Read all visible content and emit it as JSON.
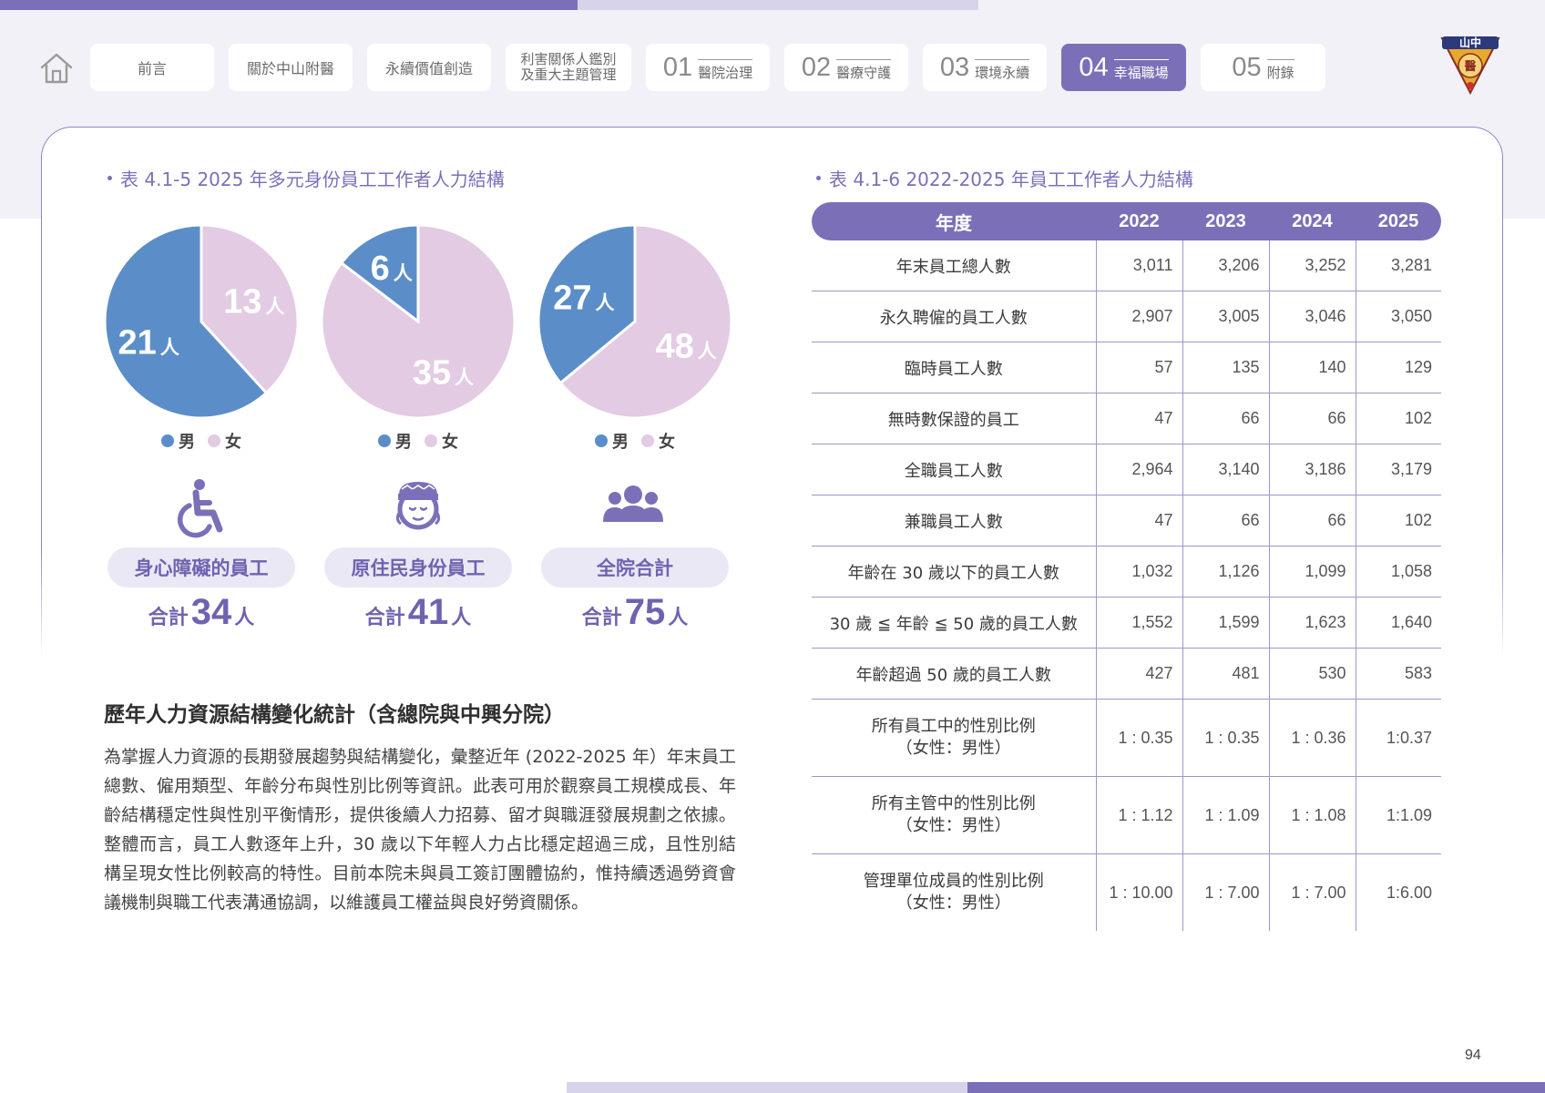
{
  "nav": {
    "tabs": [
      {
        "label": "前言"
      },
      {
        "label": "關於中山附醫"
      },
      {
        "label": "永續價值創造"
      },
      {
        "label_line1": "利害關係人鑑別",
        "label_line2": "及重大主題管理"
      },
      {
        "num": "01",
        "label": "醫院治理"
      },
      {
        "num": "02",
        "label": "醫療守護"
      },
      {
        "num": "03",
        "label": "環境永續"
      },
      {
        "num": "04",
        "label": "幸福職場"
      },
      {
        "num": "05",
        "label": "附錄"
      }
    ]
  },
  "logo": {
    "text": "山中",
    "text2": "醫"
  },
  "left": {
    "title": "表 4.1-5  2025 年多元身份員工工作者人力結構",
    "legend": {
      "male": "男",
      "female": "女"
    },
    "person_unit": "人",
    "total_prefix": "合計",
    "groups": [
      {
        "name": "身心障礙的員工",
        "male": "21",
        "female": "13",
        "total": "34"
      },
      {
        "name": "原住民身份員工",
        "male": "6",
        "female": "35",
        "total": "41"
      },
      {
        "name": "全院合計",
        "male": "27",
        "female": "48",
        "total": "75"
      }
    ]
  },
  "chart_data": [
    {
      "type": "pie",
      "categories": [
        "男",
        "女"
      ],
      "values": [
        21,
        13
      ],
      "colors": [
        "#5b8ec8",
        "#e2cbe3"
      ]
    },
    {
      "type": "pie",
      "categories": [
        "男",
        "女"
      ],
      "values": [
        6,
        35
      ],
      "colors": [
        "#5b8ec8",
        "#e2cbe3"
      ]
    },
    {
      "type": "pie",
      "categories": [
        "男",
        "女"
      ],
      "values": [
        27,
        48
      ],
      "colors": [
        "#5b8ec8",
        "#e2cbe3"
      ]
    }
  ],
  "section": {
    "heading": "歷年人力資源結構變化統計（含總院與中興分院）",
    "paragraph": "為掌握人力資源的長期發展趨勢與結構變化，彙整近年 (2022-2025 年）年末員工總數、僱用類型、年齡分布與性別比例等資訊。此表可用於觀察員工規模成長、年齡結構穩定性與性別平衡情形，提供後續人力招募、留才與職涯發展規劃之依據。整體而言，員工人數逐年上升，30 歲以下年輕人力占比穩定超過三成，且性別結構呈現女性比例較高的特性。目前本院未與員工簽訂團體協約，惟持續透過勞資會議機制與職工代表溝通協調，以維護員工權益與良好勞資關係。"
  },
  "right": {
    "title": "表 4.1-6  2022-2025 年員工工作者人力結構",
    "headers": [
      "年度",
      "2022",
      "2023",
      "2024",
      "2025"
    ],
    "rows": [
      {
        "label": "年末員工總人數",
        "v": [
          "3,011",
          "3,206",
          "3,252",
          "3,281"
        ]
      },
      {
        "label": "永久聘僱的員工人數",
        "v": [
          "2,907",
          "3,005",
          "3,046",
          "3,050"
        ]
      },
      {
        "label": "臨時員工人數",
        "v": [
          "57",
          "135",
          "140",
          "129"
        ]
      },
      {
        "label": "無時數保證的員工",
        "v": [
          "47",
          "66",
          "66",
          "102"
        ]
      },
      {
        "label": "全職員工人數",
        "v": [
          "2,964",
          "3,140",
          "3,186",
          "3,179"
        ]
      },
      {
        "label": "兼職員工人數",
        "v": [
          "47",
          "66",
          "66",
          "102"
        ]
      },
      {
        "label": "年齡在 30 歲以下的員工人數",
        "v": [
          "1,032",
          "1,126",
          "1,099",
          "1,058"
        ]
      },
      {
        "label": "30 歲 ≦ 年齡 ≦ 50 歲的員工人數",
        "v": [
          "1,552",
          "1,599",
          "1,623",
          "1,640"
        ]
      },
      {
        "label": "年齡超過 50 歲的員工人數",
        "v": [
          "427",
          "481",
          "530",
          "583"
        ]
      },
      {
        "label": "所有員工中的性別比例",
        "label2": "（女性：男性）",
        "v": [
          "1 : 0.35",
          "1 : 0.35",
          "1 : 0.36",
          "1:0.37"
        ]
      },
      {
        "label": "所有主管中的性別比例",
        "label2": "（女性：男性）",
        "v": [
          "1 : 1.12",
          "1 : 1.09",
          "1 : 1.08",
          "1:1.09"
        ]
      },
      {
        "label": "管理單位成員的性別比例",
        "label2": "（女性：男性）",
        "v": [
          "1 : 10.00",
          "1 : 7.00",
          "1 : 7.00",
          "1:6.00"
        ]
      }
    ]
  },
  "page": {
    "number": "94"
  }
}
